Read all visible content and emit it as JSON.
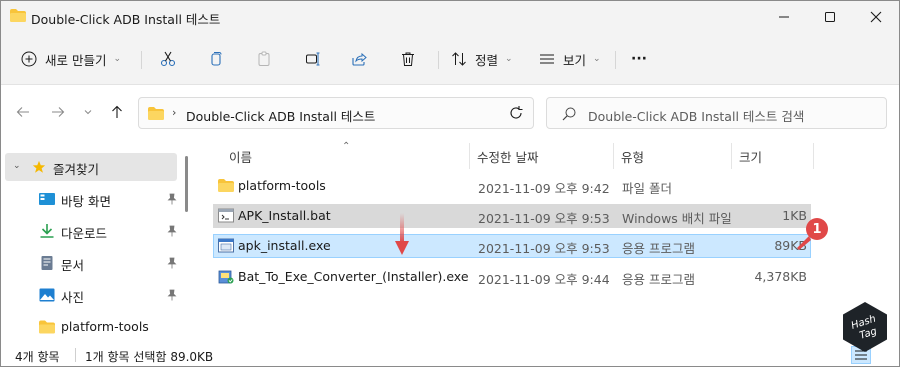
{
  "window": {
    "title": "Double-Click ADB Install 테스트"
  },
  "toolbar": {
    "new_label": "새로 만들기",
    "sort_label": "정렬",
    "view_label": "보기",
    "more_label": "···"
  },
  "address": {
    "path": "Double-Click ADB Install 테스트",
    "search_placeholder": "Double-Click ADB Install 테스트 검색"
  },
  "nav": {
    "items": [
      {
        "label": "즐겨찾기",
        "icon": "star-icon"
      },
      {
        "label": "바탕 화면",
        "icon": "desktop-icon"
      },
      {
        "label": "다운로드",
        "icon": "download-icon"
      },
      {
        "label": "문서",
        "icon": "document-icon"
      },
      {
        "label": "사진",
        "icon": "picture-icon"
      },
      {
        "label": "platform-tools",
        "icon": "folder-icon"
      }
    ]
  },
  "columns": {
    "name": "이름",
    "date": "수정한 날짜",
    "type": "유형",
    "size": "크기"
  },
  "files": [
    {
      "name": "platform-tools",
      "date": "2021-11-09 오후 9:42",
      "type": "파일 폴더",
      "size": "",
      "icon": "folder-icon"
    },
    {
      "name": "APK_Install.bat",
      "date": "2021-11-09 오후 9:53",
      "type": "Windows 배치 파일",
      "size": "1KB",
      "icon": "batch-file-icon"
    },
    {
      "name": "apk_install.exe",
      "date": "2021-11-09 오후 9:53",
      "type": "응용 프로그램",
      "size": "89KB",
      "icon": "exe-file-icon"
    },
    {
      "name": "Bat_To_Exe_Converter_(Installer).exe",
      "date": "2021-11-09 오후 9:44",
      "type": "응용 프로그램",
      "size": "4,378KB",
      "icon": "installer-icon"
    }
  ],
  "status": {
    "count": "4개 항목",
    "selection": "1개 항목 선택함 89.0KB"
  },
  "annotation": {
    "badge_number": "1"
  },
  "logo": {
    "text": "Hash Tag"
  },
  "colors": {
    "accent_blue": "#0078d4",
    "selection_bg": "#cce8ff",
    "selection_border": "#99d1ff",
    "folder_yellow": "#f8c43a",
    "annotation_red": "#e04848"
  }
}
